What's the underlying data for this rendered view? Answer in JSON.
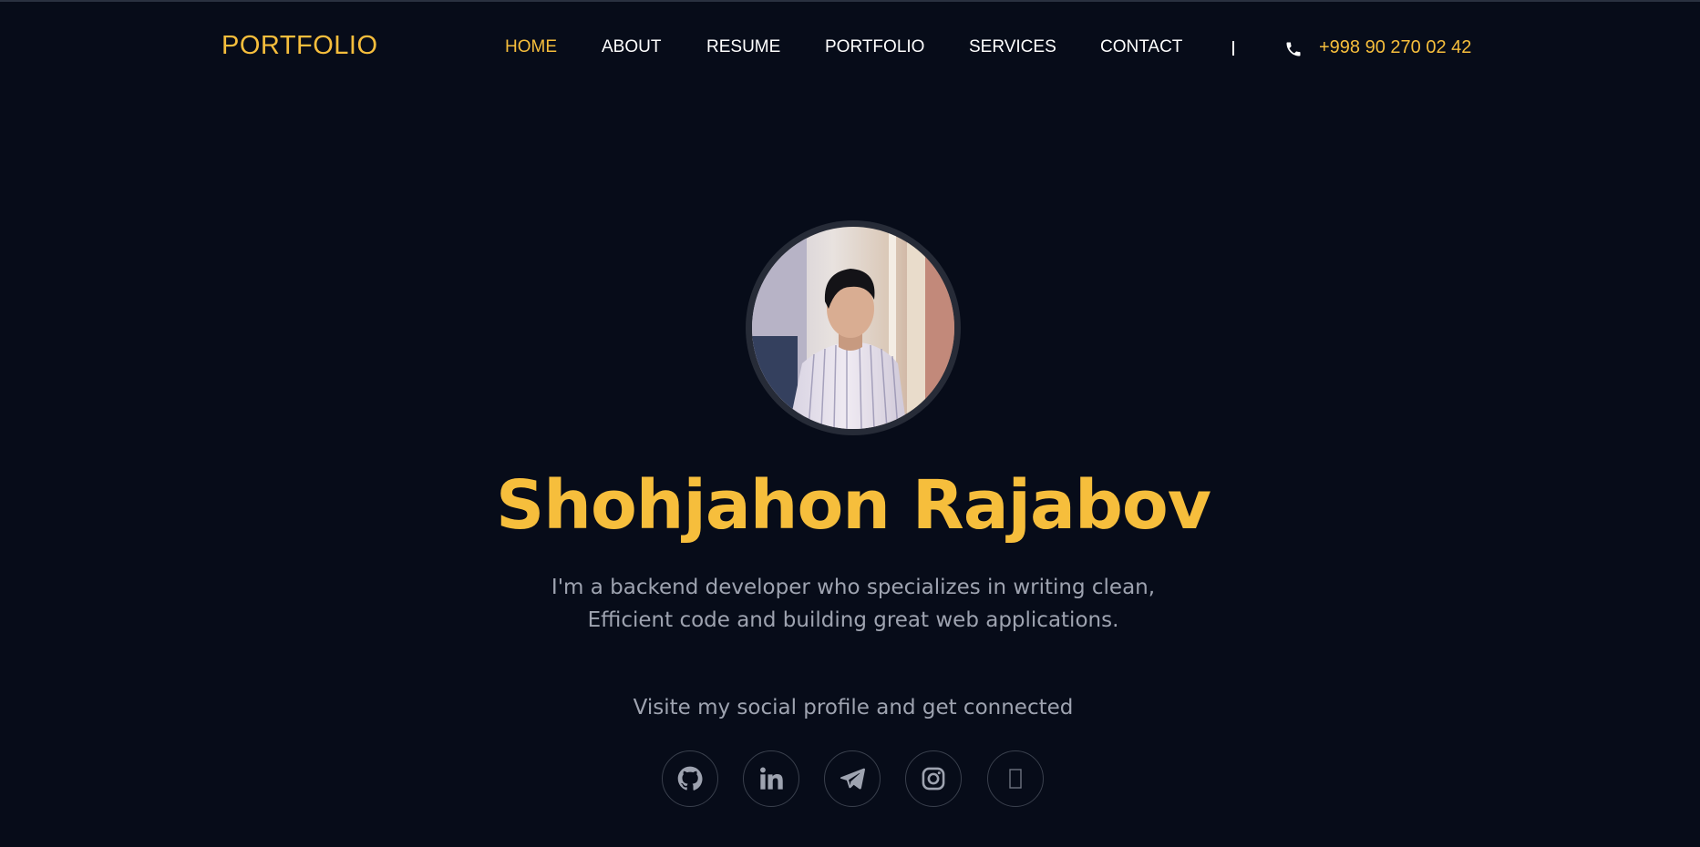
{
  "brand": "PORTFOLIO",
  "nav": {
    "items": [
      {
        "label": "HOME",
        "active": true
      },
      {
        "label": "ABOUT",
        "active": false
      },
      {
        "label": "RESUME",
        "active": false
      },
      {
        "label": "PORTFOLIO",
        "active": false
      },
      {
        "label": "SERVICES",
        "active": false
      },
      {
        "label": "CONTACT",
        "active": false
      }
    ],
    "phone_icon": "phone-icon",
    "phone": "+998 90 270 02 42"
  },
  "hero": {
    "avatar_icon": "profile-photo",
    "name": "Shohjahon Rajabov",
    "description_line1": "I'm a backend developer who specializes in writing clean,",
    "description_line2": "Efficient code and building great web applications.",
    "social_text": "Visite my social profile and get connected"
  },
  "social": [
    {
      "icon": "github-icon"
    },
    {
      "icon": "linkedin-icon"
    },
    {
      "icon": "telegram-icon"
    },
    {
      "icon": "instagram-icon"
    },
    {
      "icon": "missing-glyph-icon"
    }
  ],
  "colors": {
    "background": "#070c19",
    "accent": "#f6be3c",
    "text_muted": "#9ea3b0",
    "nav_text": "#ffffff"
  }
}
